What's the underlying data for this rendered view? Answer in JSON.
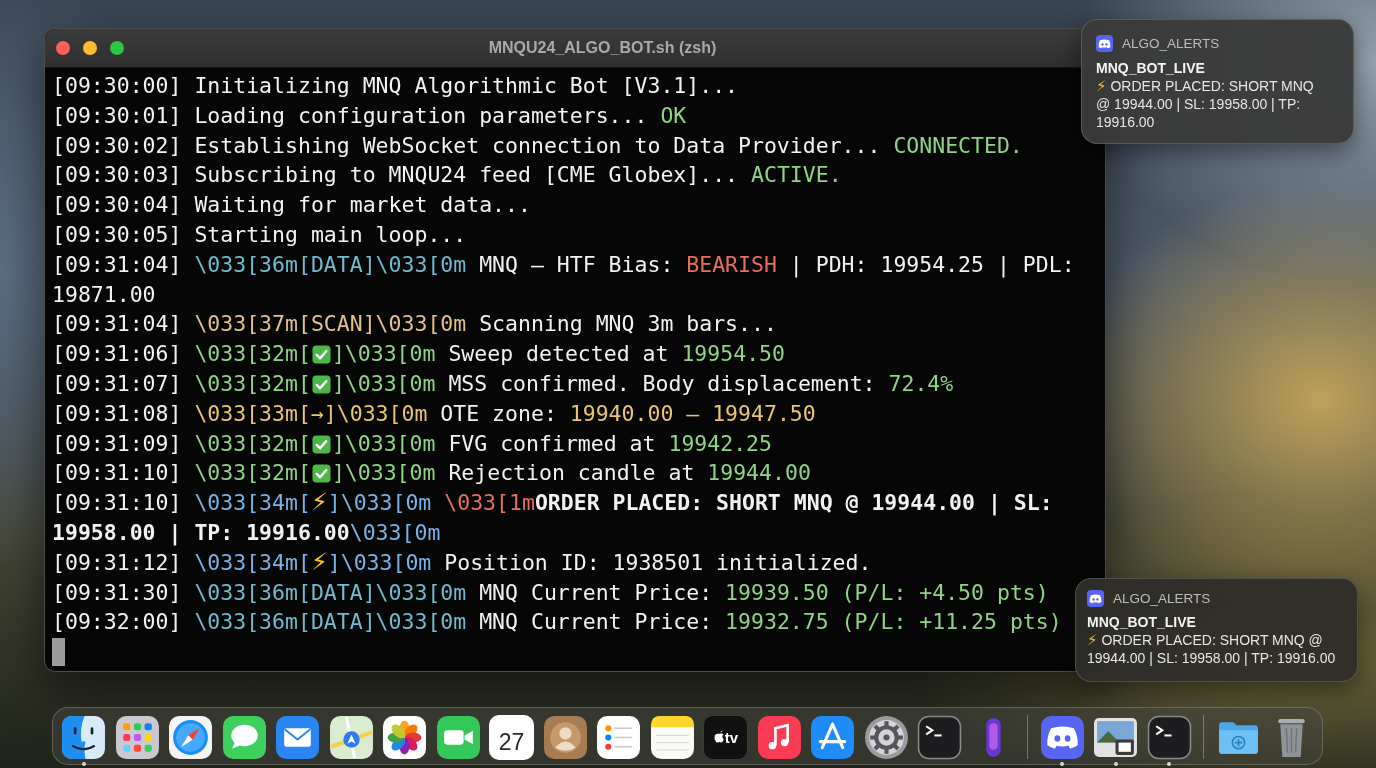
{
  "window": {
    "title": "MNQU24_ALGO_BOT.sh (zsh)"
  },
  "terminal": {
    "rows": [
      {
        "segments": [
          {
            "kind": "time",
            "text": "[09:30:00] "
          },
          {
            "kind": "text",
            "text": "Initializing MNQ Algorithmic Bot [V3.1]..."
          }
        ]
      },
      {
        "segments": [
          {
            "kind": "time",
            "text": "[09:30:01] "
          },
          {
            "kind": "text",
            "text": "Loading configuration parameters... "
          },
          {
            "kind": "text",
            "text": "OK",
            "color": "#8fd483"
          }
        ]
      },
      {
        "segments": [
          {
            "kind": "time",
            "text": "[09:30:02] "
          },
          {
            "kind": "text",
            "text": "Establishing WebSocket connection to Data Provider... "
          },
          {
            "kind": "text",
            "text": "CONNECTED.",
            "color": "#8fd483"
          }
        ]
      },
      {
        "segments": [
          {
            "kind": "time",
            "text": "[09:30:03] "
          },
          {
            "kind": "text",
            "text": "Subscribing to MNQU24 feed [CME Globex]... "
          },
          {
            "kind": "text",
            "text": "ACTIVE.",
            "color": "#8fd483"
          }
        ]
      },
      {
        "segments": [
          {
            "kind": "time",
            "text": "[09:30:04] "
          },
          {
            "kind": "text",
            "text": "Waiting for market data..."
          }
        ]
      },
      {
        "segments": [
          {
            "kind": "time",
            "text": "[09:30:05] "
          },
          {
            "kind": "text",
            "text": "Starting main loop..."
          }
        ]
      },
      {
        "segments": [
          {
            "kind": "time",
            "text": "[09:31:04] "
          },
          {
            "kind": "text",
            "text": "\\033[36m[DATA]\\033[0m",
            "color": "#6fbccd"
          },
          {
            "kind": "text",
            "text": " MNQ – HTF Bias: "
          },
          {
            "kind": "text",
            "text": "BEARISH",
            "color": "#e4705c"
          },
          {
            "kind": "text",
            "text": " | PDH: 19954.25 | PDL:"
          }
        ]
      },
      {
        "segments": [
          {
            "kind": "text",
            "text": "19871.00"
          }
        ]
      },
      {
        "segments": [
          {
            "kind": "time",
            "text": "[09:31:04] "
          },
          {
            "kind": "text",
            "text": "\\033[37m[SCAN]\\033[0m",
            "color": "#e2c08d"
          },
          {
            "kind": "text",
            "text": " Scanning MNQ 3m bars..."
          }
        ]
      },
      {
        "segments": [
          {
            "kind": "time",
            "text": "[09:31:06] "
          },
          {
            "kind": "text",
            "text": "\\033[32m[",
            "color": "#8fd483"
          },
          {
            "kind": "check"
          },
          {
            "kind": "text",
            "text": "]\\033[0m",
            "color": "#8fd483"
          },
          {
            "kind": "text",
            "text": " Sweep detected at "
          },
          {
            "kind": "text",
            "text": "19954.50",
            "color": "#8fd483"
          }
        ]
      },
      {
        "segments": [
          {
            "kind": "time",
            "text": "[09:31:07] "
          },
          {
            "kind": "text",
            "text": "\\033[32m[",
            "color": "#8fd483"
          },
          {
            "kind": "check"
          },
          {
            "kind": "text",
            "text": "]\\033[0m",
            "color": "#8fd483"
          },
          {
            "kind": "text",
            "text": " MSS confirmed. Body displacement: "
          },
          {
            "kind": "text",
            "text": "72.4%",
            "color": "#8fd483"
          }
        ]
      },
      {
        "segments": [
          {
            "kind": "time",
            "text": "[09:31:08] "
          },
          {
            "kind": "text",
            "text": "\\033[33m[→]\\033[0m",
            "color": "#e8c56e"
          },
          {
            "kind": "text",
            "text": " OTE zone: "
          },
          {
            "kind": "text",
            "text": "19940.00 – 19947.50",
            "color": "#e8c56e"
          }
        ]
      },
      {
        "segments": [
          {
            "kind": "time",
            "text": "[09:31:09] "
          },
          {
            "kind": "text",
            "text": "\\033[32m[",
            "color": "#8fd483"
          },
          {
            "kind": "check"
          },
          {
            "kind": "text",
            "text": "]\\033[0m",
            "color": "#8fd483"
          },
          {
            "kind": "text",
            "text": " FVG confirmed at "
          },
          {
            "kind": "text",
            "text": "19942.25",
            "color": "#8fd483"
          }
        ]
      },
      {
        "segments": [
          {
            "kind": "time",
            "text": "[09:31:10] "
          },
          {
            "kind": "text",
            "text": "\\033[32m[",
            "color": "#8fd483"
          },
          {
            "kind": "check"
          },
          {
            "kind": "text",
            "text": "]\\033[0m",
            "color": "#8fd483"
          },
          {
            "kind": "text",
            "text": " Rejection candle at "
          },
          {
            "kind": "text",
            "text": "19944.00",
            "color": "#8fd483"
          }
        ]
      },
      {
        "segments": [
          {
            "kind": "time",
            "text": "[09:31:10] "
          },
          {
            "kind": "text",
            "text": "\\033[34m[",
            "color": "#78b2e6"
          },
          {
            "kind": "symbol",
            "text": "⚡",
            "color": "#f4c430"
          },
          {
            "kind": "text",
            "text": "]\\033[0m",
            "color": "#78b2e6"
          },
          {
            "kind": "text",
            "text": " \\033[1m",
            "color": "#e4705c"
          },
          {
            "kind": "bold",
            "text": "ORDER PLACED: SHORT MNQ @ 19944.00 | SL:"
          }
        ]
      },
      {
        "segments": [
          {
            "kind": "bold",
            "text": "19958.00 | TP: 19916.00"
          },
          {
            "kind": "text",
            "text": "\\033[0m",
            "color": "#78b2e6"
          }
        ]
      },
      {
        "segments": [
          {
            "kind": "time",
            "text": "[09:31:12] "
          },
          {
            "kind": "text",
            "text": "\\033[34m[",
            "color": "#78b2e6"
          },
          {
            "kind": "symbol",
            "text": "⚡",
            "color": "#f4c430"
          },
          {
            "kind": "text",
            "text": "]\\033[0m",
            "color": "#78b2e6"
          },
          {
            "kind": "text",
            "text": " Position ID: 1938501 initialized."
          }
        ]
      },
      {
        "segments": [
          {
            "kind": "time",
            "text": "[09:31:30] "
          },
          {
            "kind": "text",
            "text": "\\033[36m[DATA]\\033[0m",
            "color": "#6fbccd"
          },
          {
            "kind": "text",
            "text": " MNQ Current Price: "
          },
          {
            "kind": "text",
            "text": "19939.50 (P/L: +4.50 pts)",
            "color": "#8fd483"
          }
        ]
      },
      {
        "segments": [
          {
            "kind": "time",
            "text": "[09:32:00] "
          },
          {
            "kind": "text",
            "text": "\\033[36m[DATA]\\033[0m",
            "color": "#6fbccd"
          },
          {
            "kind": "text",
            "text": " MNQ Current Price: "
          },
          {
            "kind": "text",
            "text": "19932.75 (P/L: +11.25 pts)",
            "color": "#8fd483"
          }
        ]
      }
    ]
  },
  "notifications": [
    {
      "app": "ALGO_ALERTS",
      "title": "MNQ_BOT_LIVE",
      "symbol": "⚡",
      "message": "ORDER PLACED: SHORT MNQ @ 19944.00 | SL: 19958.00 | TP: 19916.00"
    },
    {
      "app": "ALGO_ALERTS",
      "title": "MNQ_BOT_LIVE",
      "symbol": "⚡",
      "message": "ORDER PLACED: SHORT MNQ @ 19944.00 | SL: 19958.00 | TP: 19916.00"
    }
  ],
  "dock": {
    "sections": [
      {
        "items": [
          {
            "kind": "finder",
            "running": true
          },
          {
            "kind": "launchpad",
            "running": false
          },
          {
            "kind": "safari",
            "running": false
          },
          {
            "kind": "messages",
            "running": false
          },
          {
            "kind": "mail",
            "running": false
          },
          {
            "kind": "maps",
            "running": false
          },
          {
            "kind": "photos",
            "running": false
          },
          {
            "kind": "facetime",
            "running": false
          },
          {
            "kind": "calendar",
            "label": "27",
            "running": false
          },
          {
            "kind": "contacts",
            "running": false
          },
          {
            "kind": "reminders",
            "running": false
          },
          {
            "kind": "notes",
            "running": false
          },
          {
            "kind": "tv",
            "label": "tv",
            "running": false
          },
          {
            "kind": "music",
            "running": false
          },
          {
            "kind": "appstore",
            "running": false
          },
          {
            "kind": "settings",
            "running": false
          },
          {
            "kind": "terminal",
            "running": false
          },
          {
            "kind": "siri",
            "running": false
          }
        ]
      },
      {
        "items": [
          {
            "kind": "discord",
            "running": true
          },
          {
            "kind": "preview",
            "running": true
          },
          {
            "kind": "terminal",
            "running": true
          }
        ]
      },
      {
        "items": [
          {
            "kind": "downloads",
            "running": false
          },
          {
            "kind": "trash",
            "running": false
          }
        ]
      }
    ]
  }
}
